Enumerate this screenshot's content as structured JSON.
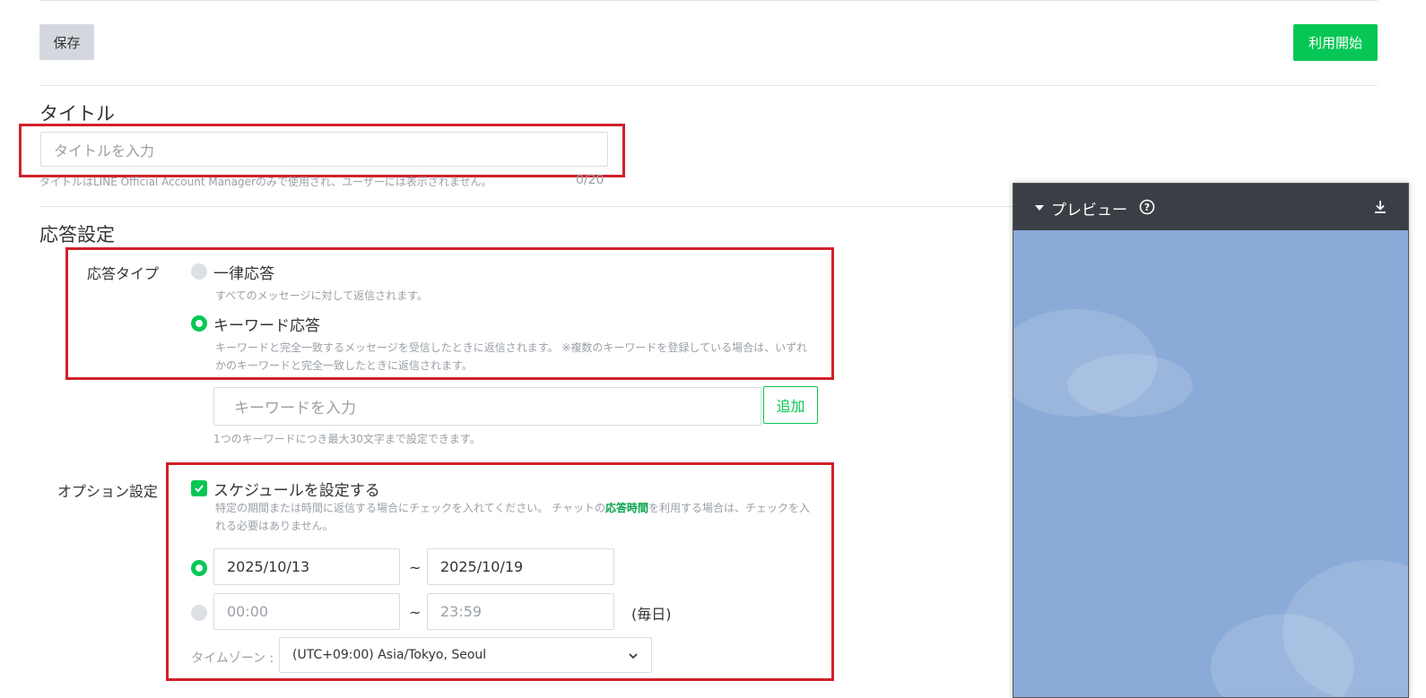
{
  "toolbar": {
    "save_label": "保存",
    "start_label": "利用開始"
  },
  "title_section": {
    "heading": "タイトル",
    "placeholder": "タイトルを入力",
    "helper": "タイトルはLINE Official Account Managerのみで使用され、ユーザーには表示されません。",
    "counter": "0/20"
  },
  "response_section": {
    "heading": "応答設定",
    "type_label": "応答タイプ",
    "option_uniform": {
      "label": "一律応答",
      "desc": "すべてのメッセージに対して返信されます。",
      "selected": false
    },
    "option_keyword": {
      "label": "キーワード応答",
      "desc": "キーワードと完全一致するメッセージを受信したときに返信されます。 ※複数のキーワードを登録している場合は、いずれかのキーワードと完全一致したときに返信されます。",
      "selected": true
    },
    "keyword_placeholder": "キーワードを入力",
    "add_label": "追加",
    "keyword_helper": "1つのキーワードにつき最大30文字まで設定できます。"
  },
  "options_section": {
    "label": "オプション設定",
    "schedule_checkbox_label": "スケジュールを設定する",
    "schedule_checked": true,
    "schedule_desc_before": "特定の期間または時間に返信する場合にチェックを入れてください。 チャットの",
    "schedule_desc_link": "応答時間",
    "schedule_desc_after": "を利用する場合は、チェックを入れる必要はありません。",
    "date_from": "2025/10/13",
    "date_to": "2025/10/19",
    "tilde": "~",
    "time_from": "00:00",
    "time_to": "23:59",
    "daily_label": "(毎日)",
    "timezone_label": "タイムゾーン :",
    "timezone_value": "(UTC+09:00) Asia/Tokyo, Seoul"
  },
  "preview": {
    "title": "プレビュー"
  },
  "colors": {
    "accent": "#06c755",
    "highlight": "#d0212b",
    "preview_bg": "#8aaad8"
  },
  "icons": [
    "caret-down-icon",
    "help-icon",
    "download-icon",
    "check-icon",
    "chevron-down-icon"
  ]
}
